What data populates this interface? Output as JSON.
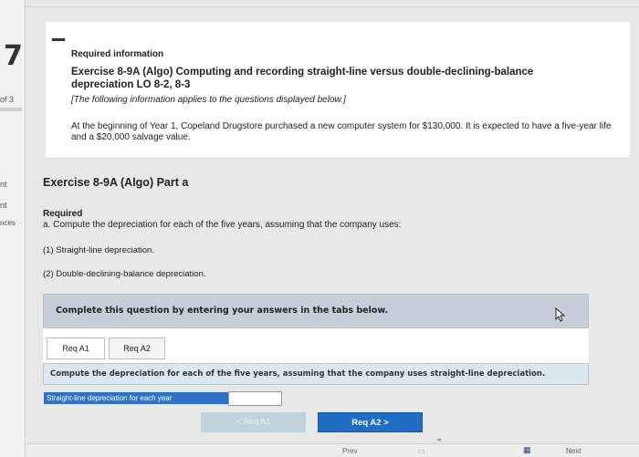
{
  "sidebar": {
    "question_number": "7",
    "of_label": "of 3",
    "label_a": "nt",
    "label_b": "nt",
    "label_c": "nces"
  },
  "info": {
    "heading": "Required information",
    "exercise_title": "Exercise 8-9A (Algo) Computing and recording straight-line versus double-declining-balance depreciation LO 8-2, 8-3",
    "note": "[The following information applies to the questions displayed below.]",
    "paragraph": "At the beginning of Year 1, Copeland Drugstore purchased a new computer system for $130,000. It is expected to have a five-year life and a $20,000 salvage value."
  },
  "part": {
    "title": "Exercise 8-9A (Algo) Part a",
    "required_label": "Required",
    "requirement": "a. Compute the depreciation for each of the five years, assuming that the company uses:",
    "option_1": "(1) Straight-line depreciation.",
    "option_2": "(2) Double-declining-balance depreciation."
  },
  "question": {
    "prompt": "Complete this question by entering your answers in the tabs below.",
    "tabs": [
      {
        "label": "Req A1"
      },
      {
        "label": "Req A2"
      }
    ],
    "instruction": "Compute the depreciation for each of the five years, assuming that the company uses straight-line depreciation.",
    "field_label": "Straight-line depreciation for each year",
    "field_value": ""
  },
  "nav": {
    "prev_label": "< Req A1",
    "next_label": "Req A2 >"
  },
  "bottom": {
    "prev": "Prev",
    "next": "Next"
  }
}
